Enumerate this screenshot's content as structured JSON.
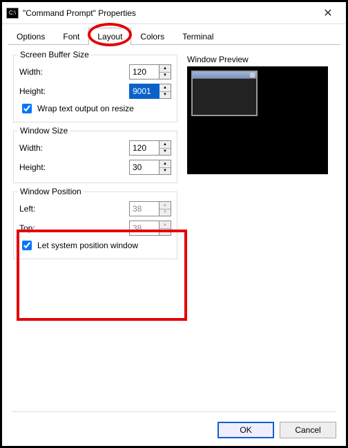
{
  "window": {
    "title": "\"Command Prompt\" Properties"
  },
  "tabs": {
    "options": "Options",
    "font": "Font",
    "layout": "Layout",
    "colors": "Colors",
    "terminal": "Terminal"
  },
  "screenBuffer": {
    "legend": "Screen Buffer Size",
    "widthLabel": "Width:",
    "width": "120",
    "heightLabel": "Height:",
    "height": "9001",
    "wrapLabel": "Wrap text output on resize"
  },
  "windowSize": {
    "legend": "Window Size",
    "widthLabel": "Width:",
    "width": "120",
    "heightLabel": "Height:",
    "height": "30"
  },
  "windowPosition": {
    "legend": "Window Position",
    "leftLabel": "Left:",
    "left": "38",
    "topLabel": "Top:",
    "top": "38",
    "autoLabel": "Let system position window"
  },
  "preview": {
    "label": "Window Preview"
  },
  "buttons": {
    "ok": "OK",
    "cancel": "Cancel"
  }
}
